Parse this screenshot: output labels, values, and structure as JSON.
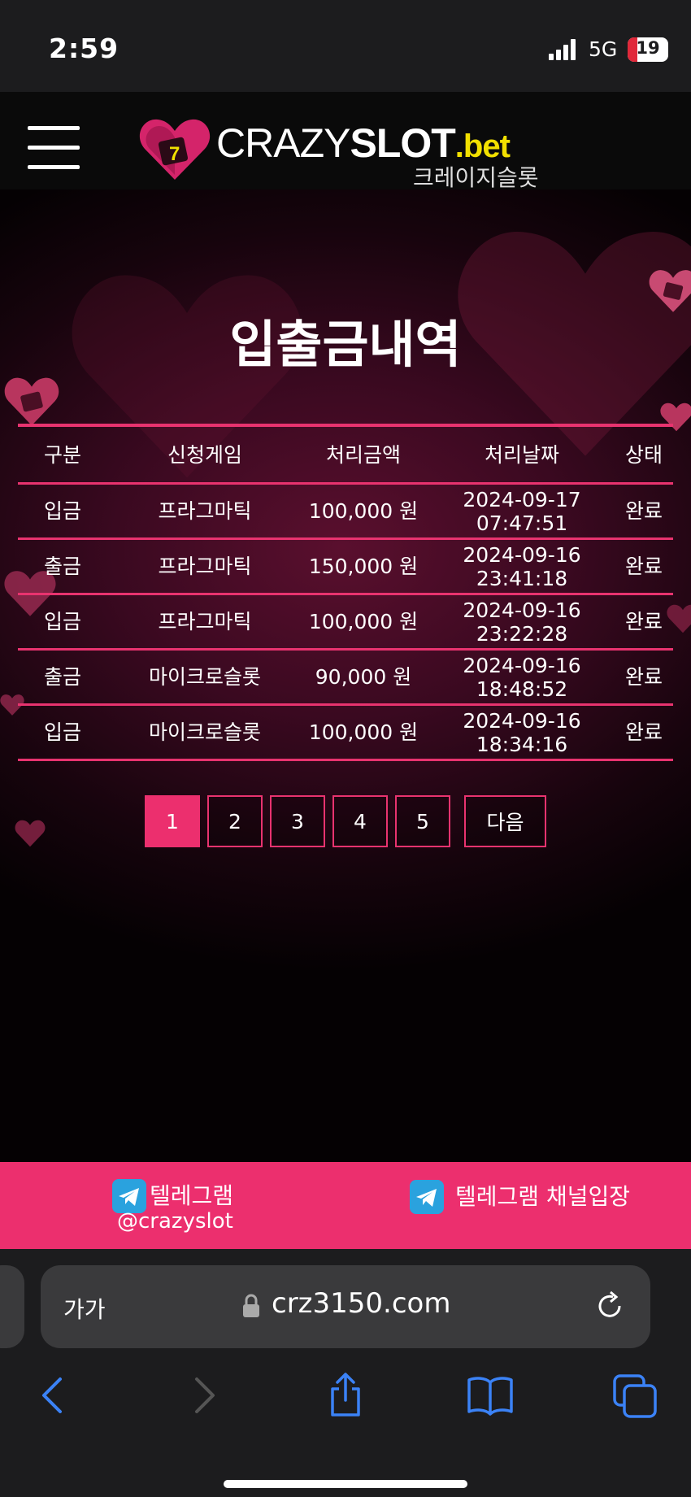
{
  "status_bar": {
    "time": "2:59",
    "network": "5G",
    "battery": "19"
  },
  "header": {
    "logo_crazy": "CRAZY",
    "logo_slot": "SLOT",
    "logo_bet": ".bet",
    "logo_sub": "크레이지슬롯",
    "logo_heart_number": "7"
  },
  "page": {
    "title": "입출금내역"
  },
  "table": {
    "headers": [
      "구분",
      "신청게임",
      "처리금액",
      "처리날짜",
      "상태"
    ],
    "rows": [
      {
        "type": "입금",
        "game": "프라그마틱",
        "amount": "100,000 원",
        "date": "2024-09-17",
        "time": "07:47:51",
        "status": "완료"
      },
      {
        "type": "출금",
        "game": "프라그마틱",
        "amount": "150,000 원",
        "date": "2024-09-16",
        "time": "23:41:18",
        "status": "완료"
      },
      {
        "type": "입금",
        "game": "프라그마틱",
        "amount": "100,000 원",
        "date": "2024-09-16",
        "time": "23:22:28",
        "status": "완료"
      },
      {
        "type": "출금",
        "game": "마이크로슬롯",
        "amount": "90,000 원",
        "date": "2024-09-16",
        "time": "18:48:52",
        "status": "완료"
      },
      {
        "type": "입금",
        "game": "마이크로슬롯",
        "amount": "100,000 원",
        "date": "2024-09-16",
        "time": "18:34:16",
        "status": "완료"
      }
    ]
  },
  "pagination": {
    "pages": [
      "1",
      "2",
      "3",
      "4",
      "5"
    ],
    "current": "1",
    "next_label": "다음"
  },
  "telegram": {
    "left_label": "텔레그램",
    "left_handle": "@crazyslot",
    "right_label": "텔레그램 채널입장"
  },
  "browser": {
    "text_size_label": "가가",
    "url": "crz3150.com"
  },
  "icons": {
    "menu": "hamburger-icon",
    "telegram": "telegram-icon",
    "lock": "lock-icon",
    "reload": "reload-icon",
    "back": "chevron-left-icon",
    "forward": "chevron-right-icon",
    "share": "share-icon",
    "bookmarks": "book-icon",
    "tabs": "tabs-icon"
  },
  "colors": {
    "accent": "#ec2f6e",
    "table_line": "#e8336f",
    "logo_bet": "#f2e000",
    "telegram": "#2aa2de",
    "ios_blue": "#3b82f6"
  }
}
